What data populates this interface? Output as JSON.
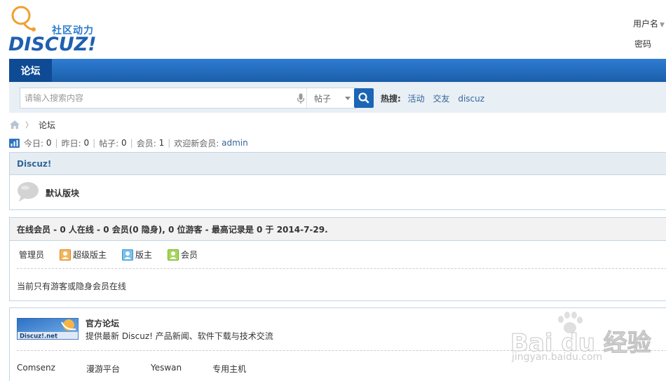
{
  "header": {
    "logo_tagline": "社区动力",
    "logo_wordmark": "DISCUZ!",
    "login_username_label": "用户名",
    "login_password_label": "密码"
  },
  "nav": {
    "tabs": [
      {
        "label": "论坛",
        "active": true
      }
    ]
  },
  "search": {
    "placeholder": "请输入搜索内容",
    "type_selected": "帖子",
    "hot_label": "热搜:",
    "hot_terms": [
      "活动",
      "交友",
      "discuz"
    ]
  },
  "breadcrumb": {
    "home_icon": "home-icon",
    "separator": "〉",
    "current": "论坛"
  },
  "stats": {
    "today_label": "今日:",
    "today_value": "0",
    "yesterday_label": "昨日:",
    "yesterday_value": "0",
    "posts_label": "帖子:",
    "posts_value": "0",
    "members_label": "会员:",
    "members_value": "1",
    "welcome_label": "欢迎新会员:",
    "newest_member": "admin"
  },
  "forum_group": {
    "title": "Discuz!",
    "forums": [
      {
        "name": "默认版块",
        "icon": "forum-bubble-icon"
      }
    ]
  },
  "online": {
    "header": "在线会员 - 0 人在线 - 0 会员(0 隐身), 0 位游客 - 最高记录是 0 于 2014-7-29.",
    "legend": [
      {
        "label": "管理员",
        "icon": ""
      },
      {
        "label": "超级版主",
        "icon": "super-moderator-icon",
        "color": "#f29c3a"
      },
      {
        "label": "版主",
        "icon": "moderator-icon",
        "color": "#4aa3df"
      },
      {
        "label": "会员",
        "icon": "member-icon",
        "color": "#7dbf2f"
      }
    ],
    "note": "当前只有游客或隐身会员在线"
  },
  "links": {
    "partner_logo_text": "Discuz!.net",
    "partner_title": "官方论坛",
    "partner_desc": "提供最新 Discuz! 产品新闻、软件下载与技术交流",
    "text_links": [
      "Comsenz",
      "漫游平台",
      "Yeswan",
      "专用主机"
    ]
  },
  "watermark": {
    "brand": "Bai du 经验",
    "url": "jingyan.baidu.com"
  },
  "colors": {
    "nav_blue": "#1a5ea9",
    "nav_active": "#0f4b94",
    "link_blue": "#336699",
    "box_border": "#c2d5e3",
    "box_head_bg": "#e5edf2"
  }
}
